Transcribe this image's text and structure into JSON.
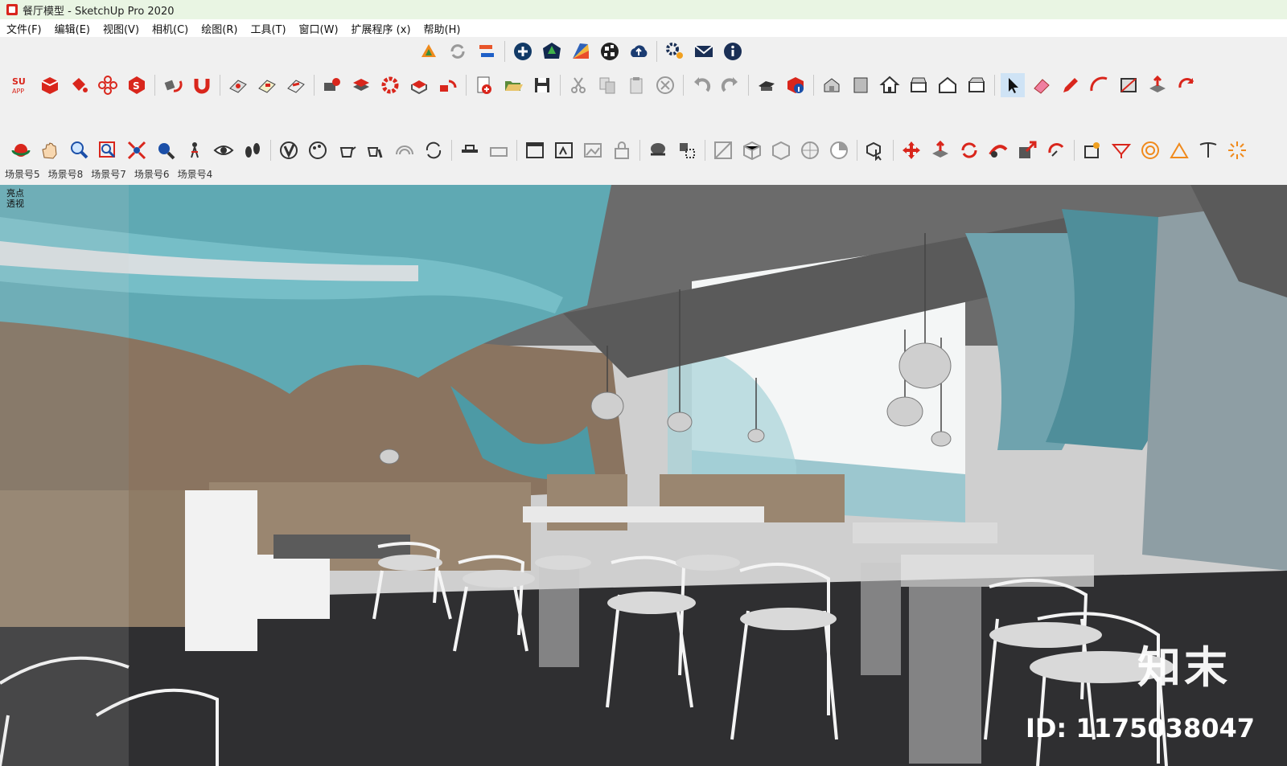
{
  "window": {
    "title": "餐厅模型 - SketchUp Pro 2020"
  },
  "menu": [
    "文件(F)",
    "编辑(E)",
    "视图(V)",
    "相机(C)",
    "绘图(R)",
    "工具(T)",
    "窗口(W)",
    "扩展程序 (x)",
    "帮助(H)"
  ],
  "scenes": [
    "场景号5",
    "场景号8",
    "场景号7",
    "场景号6",
    "场景号4"
  ],
  "viewport": {
    "style_label": "亮点",
    "camera_label": "透视"
  },
  "watermark": {
    "brand": "知末",
    "id": "ID: 1175038047"
  },
  "colors": {
    "accent_red": "#d9261c",
    "ceiling_teal": "#5fa9b3",
    "wall_brown": "#8a7460",
    "floor": "#2f2f31"
  }
}
